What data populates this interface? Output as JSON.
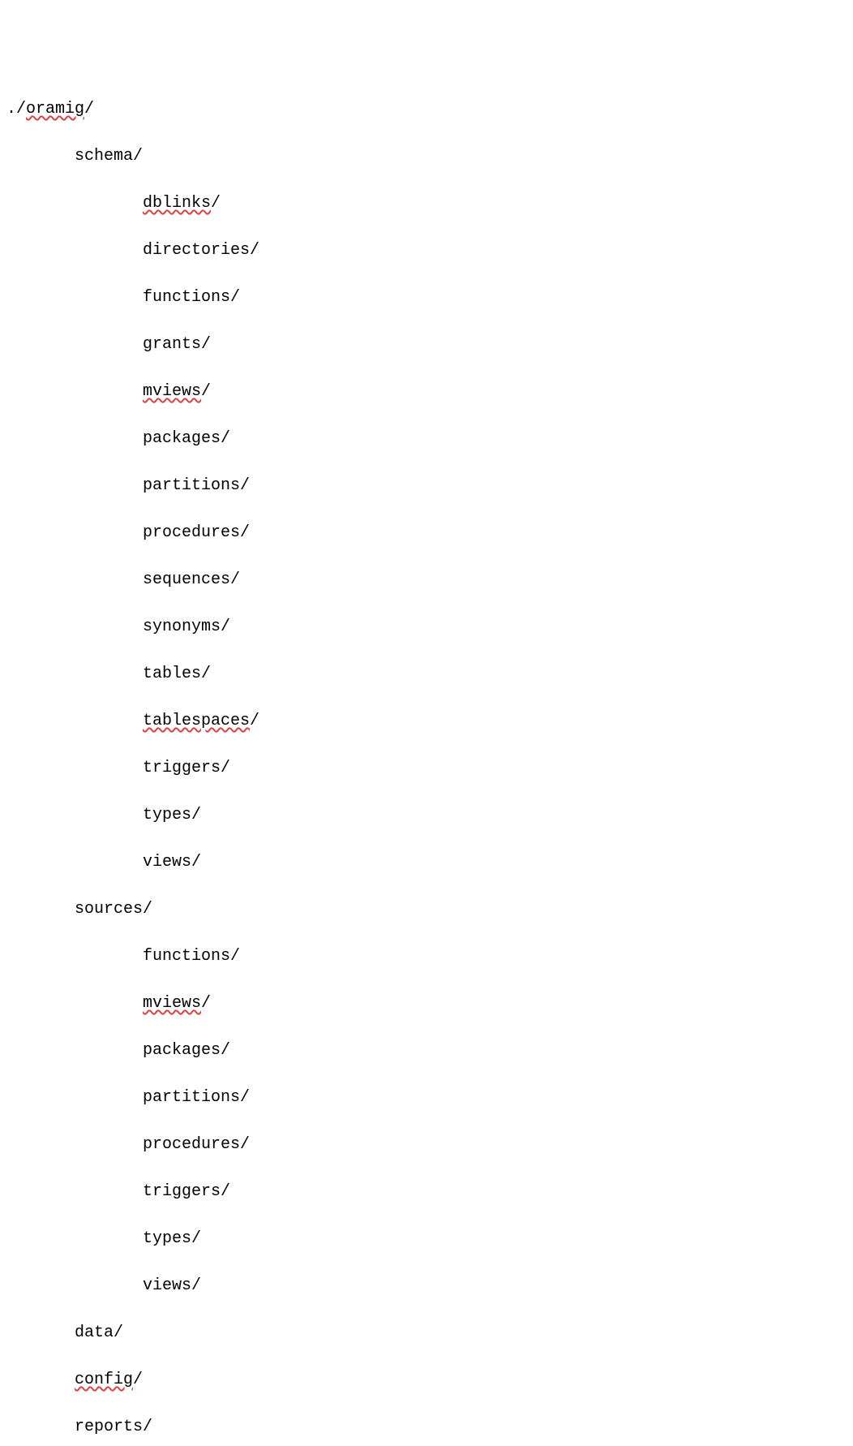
{
  "tree": {
    "root": "./",
    "rootName": "oramig",
    "rootSuffix": "/",
    "children": [
      {
        "name": "schema",
        "suffix": "/",
        "spell": false,
        "children": [
          {
            "name": "dblinks",
            "suffix": "/",
            "spell": true
          },
          {
            "name": "directories",
            "suffix": "/",
            "spell": false
          },
          {
            "name": "functions",
            "suffix": "/",
            "spell": false
          },
          {
            "name": "grants",
            "suffix": "/",
            "spell": false
          },
          {
            "name": "mviews",
            "suffix": "/",
            "spell": true
          },
          {
            "name": "packages",
            "suffix": "/",
            "spell": false
          },
          {
            "name": "partitions",
            "suffix": "/",
            "spell": false
          },
          {
            "name": "procedures",
            "suffix": "/",
            "spell": false
          },
          {
            "name": "sequences",
            "suffix": "/",
            "spell": false
          },
          {
            "name": "synonyms",
            "suffix": "/",
            "spell": false
          },
          {
            "name": "tables",
            "suffix": "/",
            "spell": false
          },
          {
            "name": "tablespaces",
            "suffix": "/",
            "spell": true
          },
          {
            "name": "triggers",
            "suffix": "/",
            "spell": false
          },
          {
            "name": "types",
            "suffix": "/",
            "spell": false
          },
          {
            "name": "views",
            "suffix": "/",
            "spell": false
          }
        ]
      },
      {
        "name": "sources",
        "suffix": "/",
        "spell": false,
        "children": [
          {
            "name": "functions",
            "suffix": "/",
            "spell": false
          },
          {
            "name": "mviews",
            "suffix": "/",
            "spell": true
          },
          {
            "name": "packages",
            "suffix": "/",
            "spell": false
          },
          {
            "name": "partitions",
            "suffix": "/",
            "spell": false
          },
          {
            "name": "procedures",
            "suffix": "/",
            "spell": false
          },
          {
            "name": "triggers",
            "suffix": "/",
            "spell": false
          },
          {
            "name": "types",
            "suffix": "/",
            "spell": false
          },
          {
            "name": "views",
            "suffix": "/",
            "spell": false
          }
        ]
      },
      {
        "name": "data",
        "suffix": "/",
        "spell": false
      },
      {
        "name": "config",
        "suffix": "/",
        "spell": true
      },
      {
        "name": "reports",
        "suffix": "/",
        "spell": false
      }
    ]
  }
}
